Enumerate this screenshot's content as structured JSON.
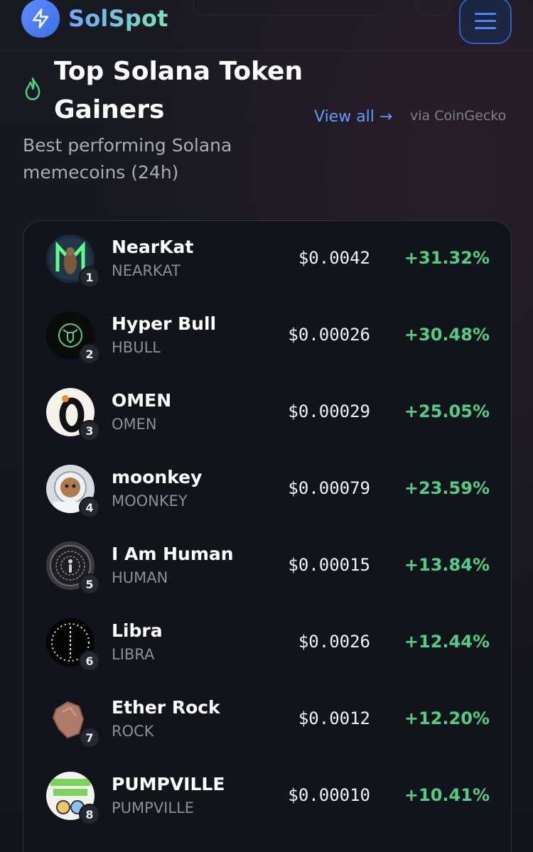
{
  "brand": {
    "name": "SolSpot"
  },
  "section": {
    "title": "Top Solana Token Gainers",
    "subtitle": "Best performing Solana memecoins (24h)",
    "view_all": "View all →",
    "source": "via CoinGecko"
  },
  "tokens": [
    {
      "rank": "1",
      "name": "NearKat",
      "symbol": "NEARKAT",
      "price": "$0.0042",
      "change": "+31.32%"
    },
    {
      "rank": "2",
      "name": "Hyper Bull",
      "symbol": "HBULL",
      "price": "$0.00026",
      "change": "+30.48%"
    },
    {
      "rank": "3",
      "name": "OMEN",
      "symbol": "OMEN",
      "price": "$0.00029",
      "change": "+25.05%"
    },
    {
      "rank": "4",
      "name": "moonkey",
      "symbol": "MOONKEY",
      "price": "$0.00079",
      "change": "+23.59%"
    },
    {
      "rank": "5",
      "name": "I Am Human",
      "symbol": "HUMAN",
      "price": "$0.00015",
      "change": "+13.84%"
    },
    {
      "rank": "6",
      "name": "Libra",
      "symbol": "LIBRA",
      "price": "$0.0026",
      "change": "+12.44%"
    },
    {
      "rank": "7",
      "name": "Ether Rock",
      "symbol": "ROCK",
      "price": "$0.0012",
      "change": "+12.20%"
    },
    {
      "rank": "8",
      "name": "PUMPVILLE",
      "symbol": "PUMPVILLE",
      "price": "$0.00010",
      "change": "+10.41%"
    }
  ],
  "colors": {
    "accent": "#5f9bff",
    "positive": "#4fcf85",
    "background": "#14161e"
  }
}
